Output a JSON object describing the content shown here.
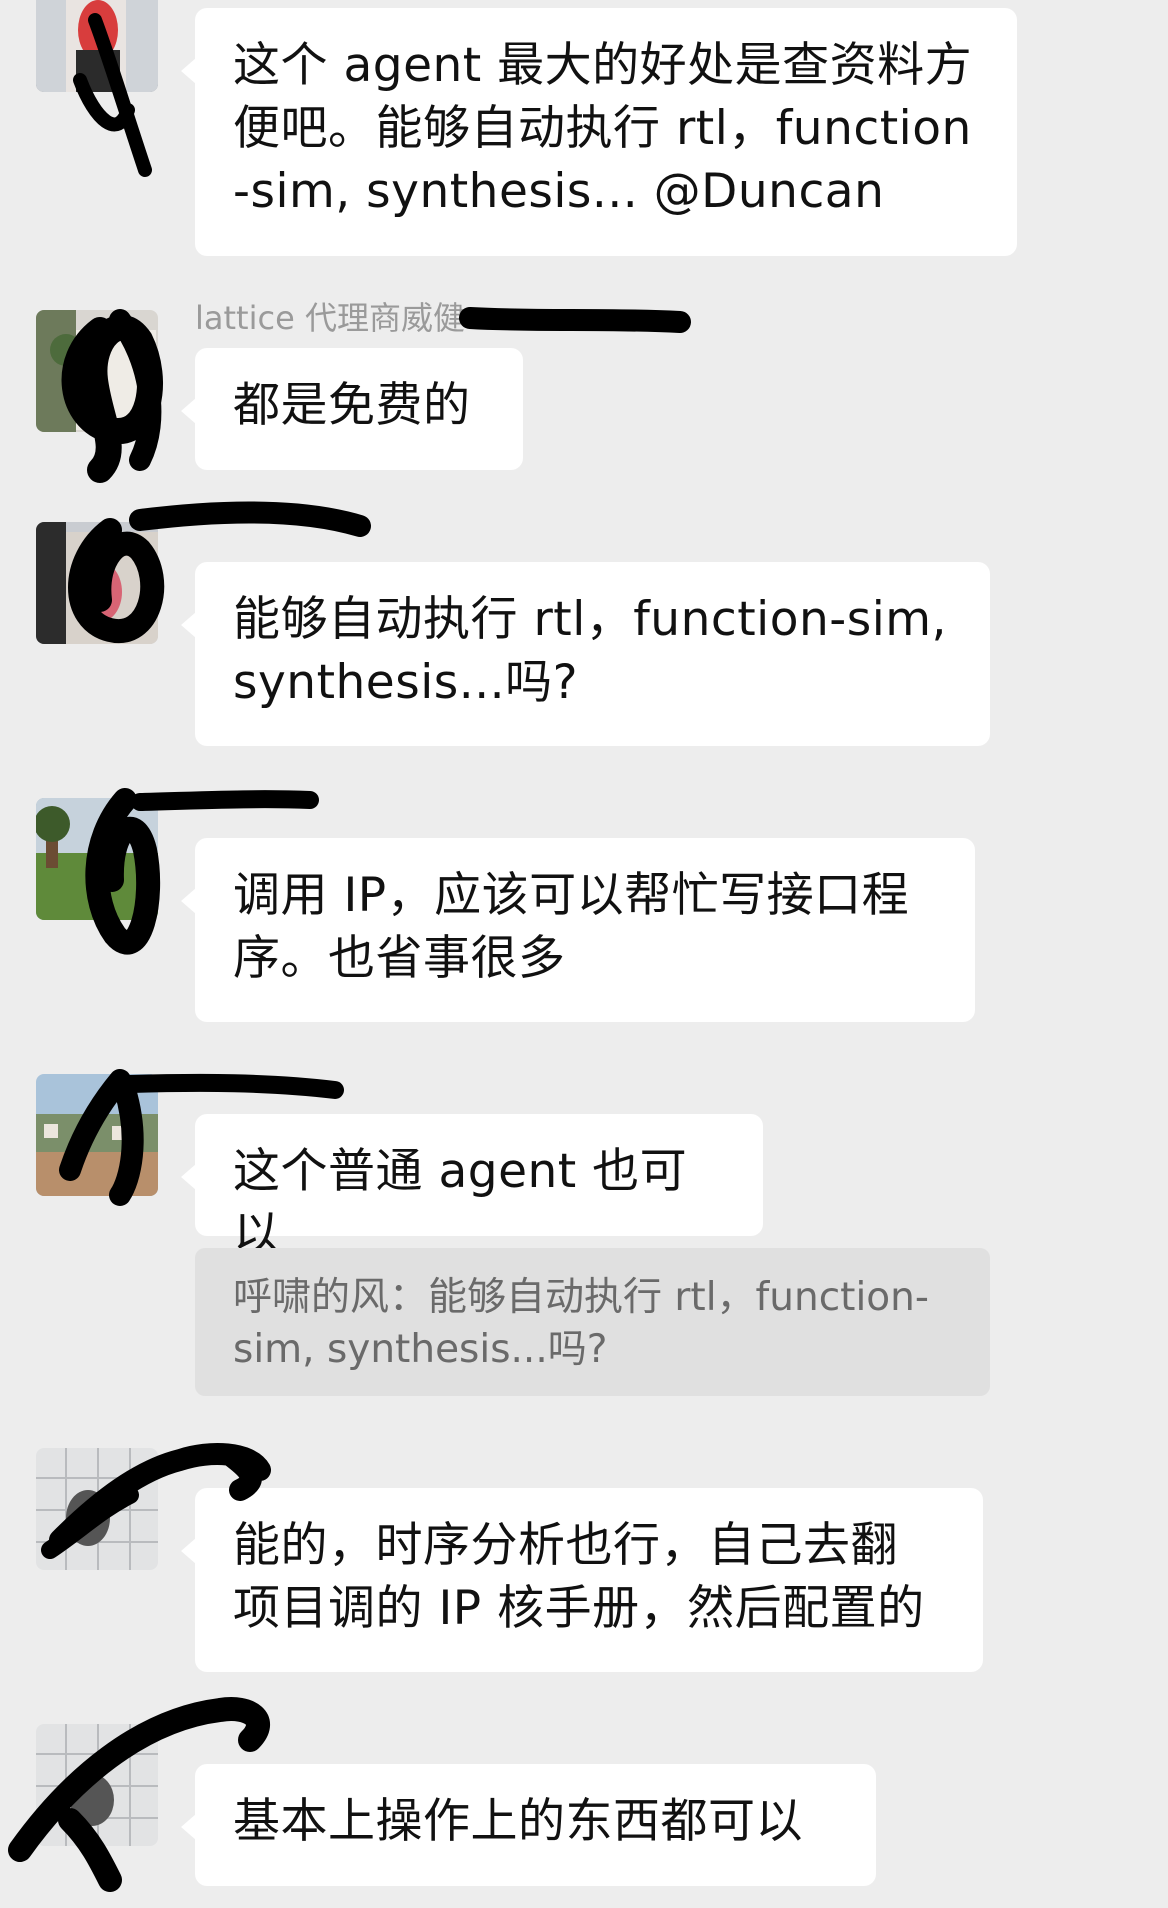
{
  "chat": {
    "messages": [
      {
        "id": "m1",
        "sender": "",
        "text_lines": [
          "这个 agent 最大的好处是查资料方",
          "便吧。能够自动执行 rtl，function",
          "-sim, synthesis...  @Duncan"
        ]
      },
      {
        "id": "m2",
        "sender": "lattice 代理商威健",
        "text_lines": [
          "都是免费的"
        ]
      },
      {
        "id": "m3",
        "sender": "",
        "text_lines": [
          "能够自动执行 rtl，function-sim,",
          "synthesis...吗?"
        ]
      },
      {
        "id": "m4",
        "sender": "",
        "text_lines": [
          "调用 IP，应该可以帮忙写接口程",
          "序。也省事很多"
        ]
      },
      {
        "id": "m5",
        "sender": "",
        "text_lines": [
          "这个普通 agent 也可以"
        ],
        "quote_lines": [
          "呼啸的风：能够自动执行 rtl，function-",
          "sim, synthesis...吗?"
        ]
      },
      {
        "id": "m6",
        "sender": "",
        "text_lines": [
          "能的，时序分析也行，自己去翻",
          "项目调的 IP 核手册，然后配置的"
        ]
      },
      {
        "id": "m7",
        "sender": "",
        "text_lines": [
          "基本上操作上的东西都可以"
        ]
      }
    ]
  },
  "colors": {
    "background": "#ededed",
    "bubble": "#ffffff",
    "quote_bg": "#e0e0e0",
    "text": "#111111",
    "sender": "#9a9a9a",
    "redaction": "#000000"
  }
}
